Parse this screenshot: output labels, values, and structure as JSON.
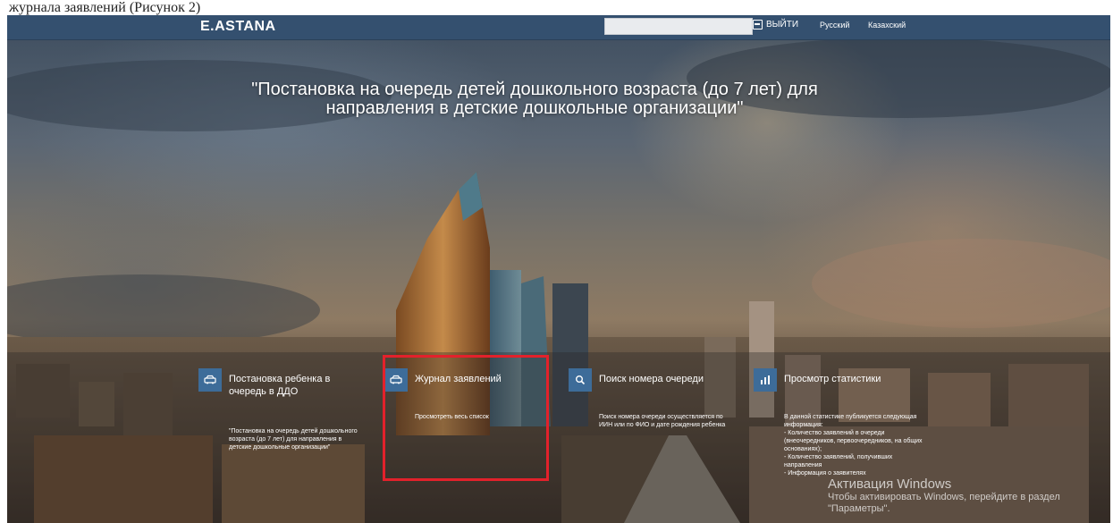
{
  "caption": "журнала заявлений (Рисунок 2)",
  "header": {
    "logo": "E.ASTANA",
    "search_placeholder": "",
    "exit_label": "ВЫЙТИ",
    "lang_ru": "Русский",
    "lang_kz": "Казахский"
  },
  "hero": {
    "title_line1": "\"Постановка на очередь детей дошкольного возраста (до 7 лет) для",
    "title_line2": "направления в детские дошкольные организации\""
  },
  "cards": [
    {
      "icon": "car-icon",
      "title_line1": "Постановка ребенка в",
      "title_line2": "очередь в ДДО",
      "desc": "\"Постановка на очередь детей дошкольного возраста (до 7 лет) для направления в детские дошкольные организации\""
    },
    {
      "icon": "car-icon",
      "title_line1": "Журнал заявлений",
      "link": "Просмотреть весь список"
    },
    {
      "icon": "search-icon",
      "title_line1": "Поиск номера очереди",
      "desc": "Поиск номера очереди осуществляется по ИИН или по ФИО и дате рождения ребенка"
    },
    {
      "icon": "bar-chart-icon",
      "title_line1": "Просмотр статистики",
      "desc_lines": [
        "В данной статистике публикуется следующая информация:",
        "- Количество заявлений в очереди (внеочередников, первоочередников, на общих основаниях);",
        "- Количество заявлений, получивших направления",
        "- Информация о заявителях"
      ]
    }
  ],
  "watermark": {
    "title": "Активация Windows",
    "subtitle": "Чтобы активировать Windows, перейдите в раздел \"Параметры\"."
  },
  "colors": {
    "topbar": "#34506f",
    "card_icon": "#3d6c99",
    "highlight": "#e3212b"
  }
}
